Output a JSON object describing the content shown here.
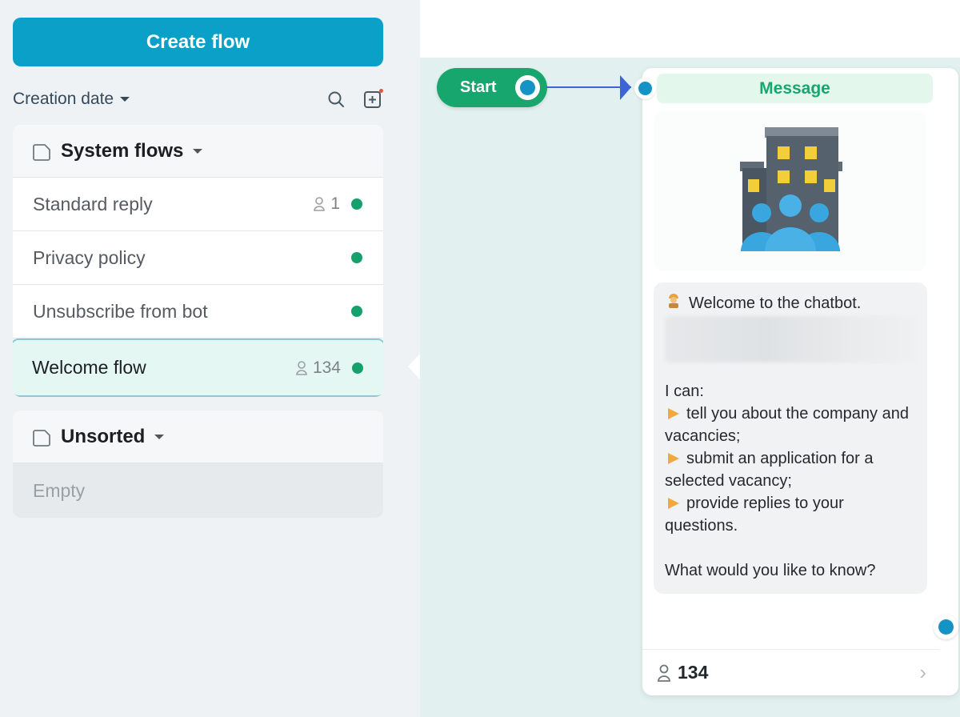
{
  "sidebar": {
    "create_label": "Create flow",
    "sort_label": "Creation date",
    "groups": [
      {
        "title": "System flows",
        "items": [
          {
            "label": "Standard reply",
            "count": "1"
          },
          {
            "label": "Privacy policy",
            "count": ""
          },
          {
            "label": "Unsubscribe from bot",
            "count": ""
          },
          {
            "label": "Welcome flow",
            "count": "134"
          }
        ]
      },
      {
        "title": "Unsorted",
        "empty_label": "Empty"
      }
    ]
  },
  "canvas": {
    "start_label": "Start",
    "message": {
      "title": "Message",
      "intro": "Welcome to the chatbot.",
      "can_label": "I can:",
      "bullets": [
        "tell you about the company and vacancies;",
        "submit an application for a selected vacancy;",
        "provide replies to your questions."
      ],
      "question": "What would you like to know?",
      "subscriber_count": "134"
    }
  },
  "colors": {
    "accent": "#0aa0c8",
    "green": "#18a66f",
    "port_blue": "#1493c4"
  },
  "icons": [
    "search-icon",
    "add-folder-icon",
    "folder-icon",
    "user-icon",
    "chevron-right-icon",
    "building-people-icon",
    "pointing-hand-icon"
  ]
}
